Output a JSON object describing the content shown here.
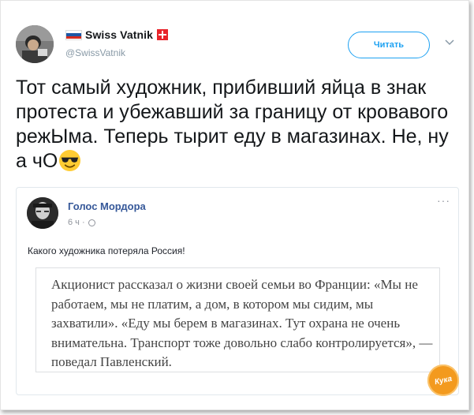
{
  "tweet": {
    "display_name": "Swiss Vatnik",
    "handle": "@SwissVatnik",
    "follow_label": "Читать",
    "text": "Тот самый художник, прибивший яйца в знак протеста и убежавший за границу от кровавого режЫма. Теперь тырит еду в магазинах. Не, ну а чО",
    "emoji": "smiling-face-with-sunglasses-icon"
  },
  "embedded_post": {
    "page_name": "Голос Мордора",
    "time": "6 ч ·",
    "dots": "···",
    "text": "Какого художника потеряла Россия!",
    "quote": "Акционист рассказал о жизни своей семьи во Франции: «Мы не работаем, мы не платим, а дом, в котором мы сидим, мы захватили». «Еду мы берем в магазинах. Тут охрана не очень внимательна. Транспорт тоже довольно слабо контролируется», — поведал Павленский."
  },
  "watermark": {
    "text": "Кука"
  },
  "colors": {
    "accent": "#1da1f2",
    "fb_link": "#365899",
    "text": "#14171a",
    "muted": "#8899a6",
    "flag_red": "#e8232a"
  }
}
